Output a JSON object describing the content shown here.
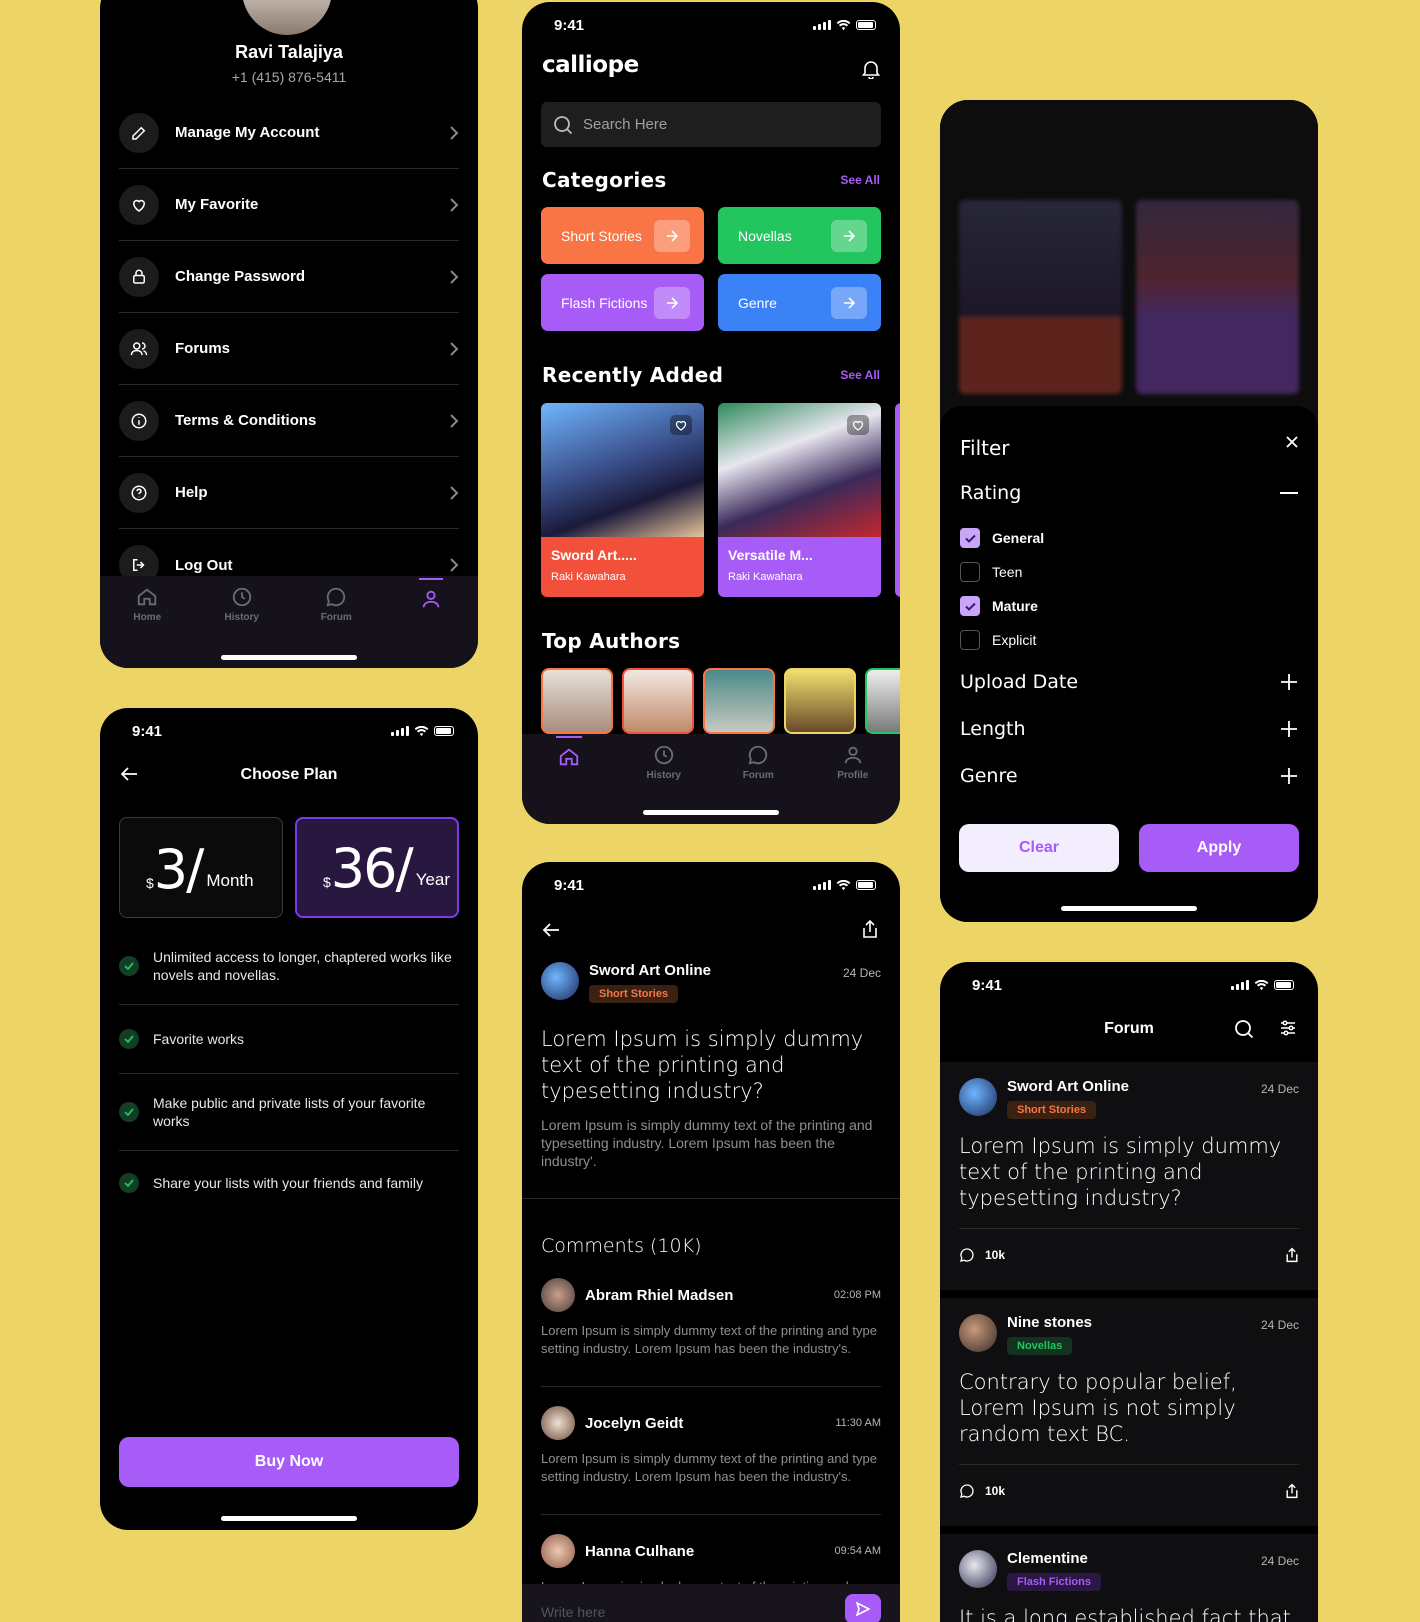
{
  "status_time": "9:41",
  "profile": {
    "name": "Ravi Talajiya",
    "phone": "+1 (415) 876-5411",
    "menu": [
      {
        "label": "Manage My Account",
        "icon": "pencil-icon"
      },
      {
        "label": "My Favorite",
        "icon": "heart-icon"
      },
      {
        "label": "Change Password",
        "icon": "lock-icon"
      },
      {
        "label": "Forums",
        "icon": "users-icon"
      },
      {
        "label": "Terms & Conditions",
        "icon": "info-icon"
      },
      {
        "label": "Help",
        "icon": "help-icon"
      },
      {
        "label": "Log Out",
        "icon": "logout-icon"
      }
    ],
    "nav": [
      {
        "label": "Home",
        "icon": "home-icon"
      },
      {
        "label": "History",
        "icon": "history-icon"
      },
      {
        "label": "Forum",
        "icon": "chat-icon"
      },
      {
        "label": "",
        "icon": "profile-icon"
      }
    ]
  },
  "plan": {
    "title": "Choose Plan",
    "options": [
      {
        "currency": "$",
        "amount": "3/",
        "period": "Month"
      },
      {
        "currency": "$",
        "amount": "36/",
        "period": "Year"
      }
    ],
    "features": [
      "Unlimited access to longer, chaptered works like novels and novellas.",
      "Favorite works",
      "Make public and private lists of your favorite works",
      "Share your lists with your friends and family"
    ],
    "buy_label": "Buy Now"
  },
  "home": {
    "logo": "calliope",
    "search_placeholder": "Search Here",
    "categories_title": "Categories",
    "see_all": "See All",
    "categories": [
      {
        "label": "Short Stories",
        "color": "#F97545"
      },
      {
        "label": "Novellas",
        "color": "#22C55E"
      },
      {
        "label": "Flash Fictions",
        "color": "#A75BF7"
      },
      {
        "label": "Genre",
        "color": "#3B82F6"
      }
    ],
    "recent_title": "Recently Added",
    "books": [
      {
        "title": "Sword Art.....",
        "author": "Raki Kawahara",
        "color": "#F3503C"
      },
      {
        "title": "Versatile M...",
        "author": "Raki Kawahara",
        "color": "#A75BF7"
      }
    ],
    "authors_title": "Top Authors",
    "nav": [
      {
        "label": "",
        "icon": "home-icon"
      },
      {
        "label": "History",
        "icon": "history-icon"
      },
      {
        "label": "Forum",
        "icon": "chat-icon"
      },
      {
        "label": "Profile",
        "icon": "profile-icon"
      }
    ]
  },
  "post": {
    "user": "Sword Art Online",
    "tag": "Short Stories",
    "date": "24 Dec",
    "title": "Lorem Ipsum is simply dummy text of the printing and typesetting industry?",
    "body": "Lorem Ipsum is simply dummy text of the printing and typesetting industry. Lorem Ipsum has been the industry'.",
    "comments_title": "Comments (10K)",
    "comments": [
      {
        "name": "Abram Rhiel Madsen",
        "time": "02:08 PM",
        "text": "Lorem Ipsum is simply dummy text of the printing and type setting industry. Lorem Ipsum has been the industry's."
      },
      {
        "name": "Jocelyn Geidt",
        "time": "11:30 AM",
        "text": "Lorem Ipsum is simply dummy text of the printing and type setting industry. Lorem Ipsum has been the industry's."
      },
      {
        "name": "Hanna Culhane",
        "time": "09:54 AM",
        "text": "Lorem Ipsum is simply dummy text of the printing and"
      }
    ],
    "write_placeholder": "Write here"
  },
  "filter": {
    "title": "Filter",
    "rating_label": "Rating",
    "options": [
      {
        "label": "General",
        "checked": true
      },
      {
        "label": "Teen",
        "checked": false
      },
      {
        "label": "Mature",
        "checked": true
      },
      {
        "label": "Explicit",
        "checked": false
      }
    ],
    "sections": [
      "Upload Date",
      "Length",
      "Genre"
    ],
    "clear_label": "Clear",
    "apply_label": "Apply"
  },
  "forum": {
    "title": "Forum",
    "posts": [
      {
        "user": "Sword Art Online",
        "tag": "Short Stories",
        "tag_style": "orange",
        "date": "24 Dec",
        "text": "Lorem Ipsum is simply dummy text of the printing and typesetting industry?",
        "count": "10k"
      },
      {
        "user": "Nine stones",
        "tag": "Novellas",
        "tag_style": "green",
        "date": "24 Dec",
        "text": "Contrary to popular belief, Lorem Ipsum is not simply random text BC.",
        "count": "10k"
      },
      {
        "user": "Clementine",
        "tag": "Flash Fictions",
        "tag_style": "purple",
        "date": "24 Dec",
        "text": "It is a long established fact that a"
      }
    ]
  }
}
